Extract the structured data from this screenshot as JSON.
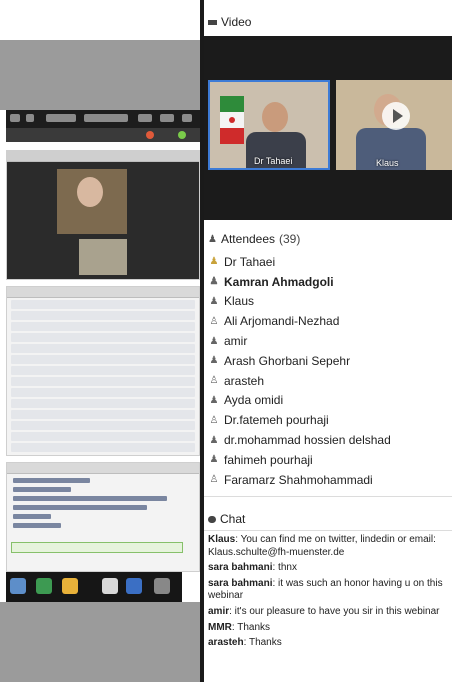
{
  "colors": {
    "active_tile_border": "#3d7bd6",
    "background": "#ffffff",
    "divider": "#1a1a1a"
  },
  "video": {
    "title": "Video",
    "tiles": [
      {
        "name": "Dr Tahaei",
        "active": true
      },
      {
        "name": "Klaus",
        "active": false
      }
    ]
  },
  "attendees": {
    "title": "Attendees",
    "count": "(39)",
    "list": [
      {
        "name": "Dr Tahaei",
        "bold": false,
        "icon": "presenter-icon"
      },
      {
        "name": "Kamran  Ahmadgoli",
        "bold": true,
        "icon": "host-icon"
      },
      {
        "name": "Klaus",
        "bold": false,
        "icon": "host-icon"
      },
      {
        "name": "Ali Arjomandi-Nezhad",
        "bold": false,
        "icon": "user-icon"
      },
      {
        "name": "amir",
        "bold": false,
        "icon": "host-icon"
      },
      {
        "name": "Arash Ghorbani   Sepehr",
        "bold": false,
        "icon": "host-icon"
      },
      {
        "name": "arasteh",
        "bold": false,
        "icon": "user-icon"
      },
      {
        "name": "Ayda omidi",
        "bold": false,
        "icon": "host-icon"
      },
      {
        "name": "Dr.fatemeh pourhaji",
        "bold": false,
        "icon": "user-icon"
      },
      {
        "name": "dr.mohammad hossien delshad",
        "bold": false,
        "icon": "host-icon"
      },
      {
        "name": "fahimeh pourhaji",
        "bold": false,
        "icon": "host-icon"
      },
      {
        "name": "Faramarz Shahmohammadi",
        "bold": false,
        "icon": "user-icon"
      }
    ]
  },
  "chat": {
    "title": "Chat",
    "messages": [
      {
        "sender": "Klaus",
        "text": ": You can find me on twitter, lindedin or email: Klaus.schulte@fh-muenster.de"
      },
      {
        "sender": "sara bahmani",
        "text": ": thnx"
      },
      {
        "sender": "sara bahmani",
        "text": ": it was such an honor having u on this webinar"
      },
      {
        "sender": "amir",
        "text": ": it's our pleasure to have you sir in this webinar"
      },
      {
        "sender": "MMR",
        "text": ": Thanks"
      },
      {
        "sender": "arasteh",
        "text": ": Thanks"
      }
    ]
  }
}
